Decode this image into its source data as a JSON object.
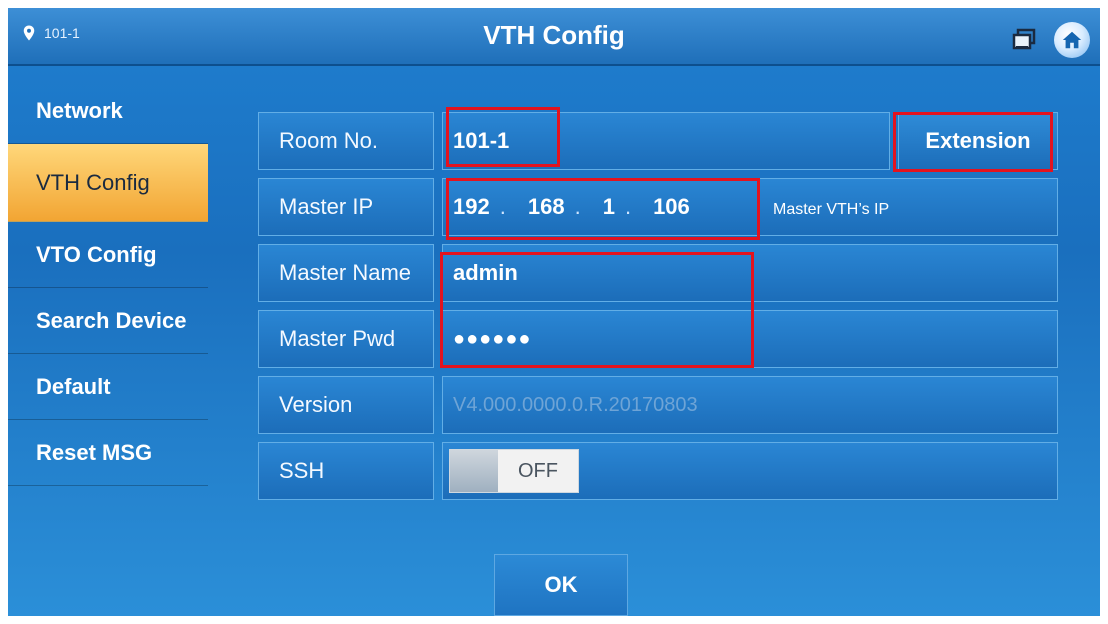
{
  "header": {
    "location": "101-1",
    "title": "VTH Config",
    "icons": [
      "location-pin-icon",
      "screens-icon",
      "home-icon"
    ]
  },
  "sidebar": {
    "items": [
      {
        "label": "Network",
        "active": false
      },
      {
        "label": "VTH Config",
        "active": true
      },
      {
        "label": "VTO Config",
        "active": false
      },
      {
        "label": "Search Device",
        "active": false
      },
      {
        "label": "Default",
        "active": false
      },
      {
        "label": "Reset MSG",
        "active": false
      }
    ]
  },
  "form": {
    "room_no": {
      "label": "Room No.",
      "value": "101-1",
      "button": "Extension"
    },
    "master_ip": {
      "label": "Master IP",
      "octets": [
        "192",
        "168",
        "1",
        "106"
      ],
      "separator": ".",
      "note": "Master VTH’s IP"
    },
    "master_name": {
      "label": "Master Name",
      "value": "admin"
    },
    "master_pwd": {
      "label": "Master Pwd",
      "value": "●●●●●●"
    },
    "version": {
      "label": "Version",
      "value": "V4.000.0000.0.R.20170803"
    },
    "ssh": {
      "label": "SSH",
      "state": "OFF"
    }
  },
  "footer": {
    "ok_label": "OK"
  },
  "colors": {
    "accent_active": "#f2a533",
    "background": "#1a6fbe",
    "annotation": "#e3131f"
  }
}
